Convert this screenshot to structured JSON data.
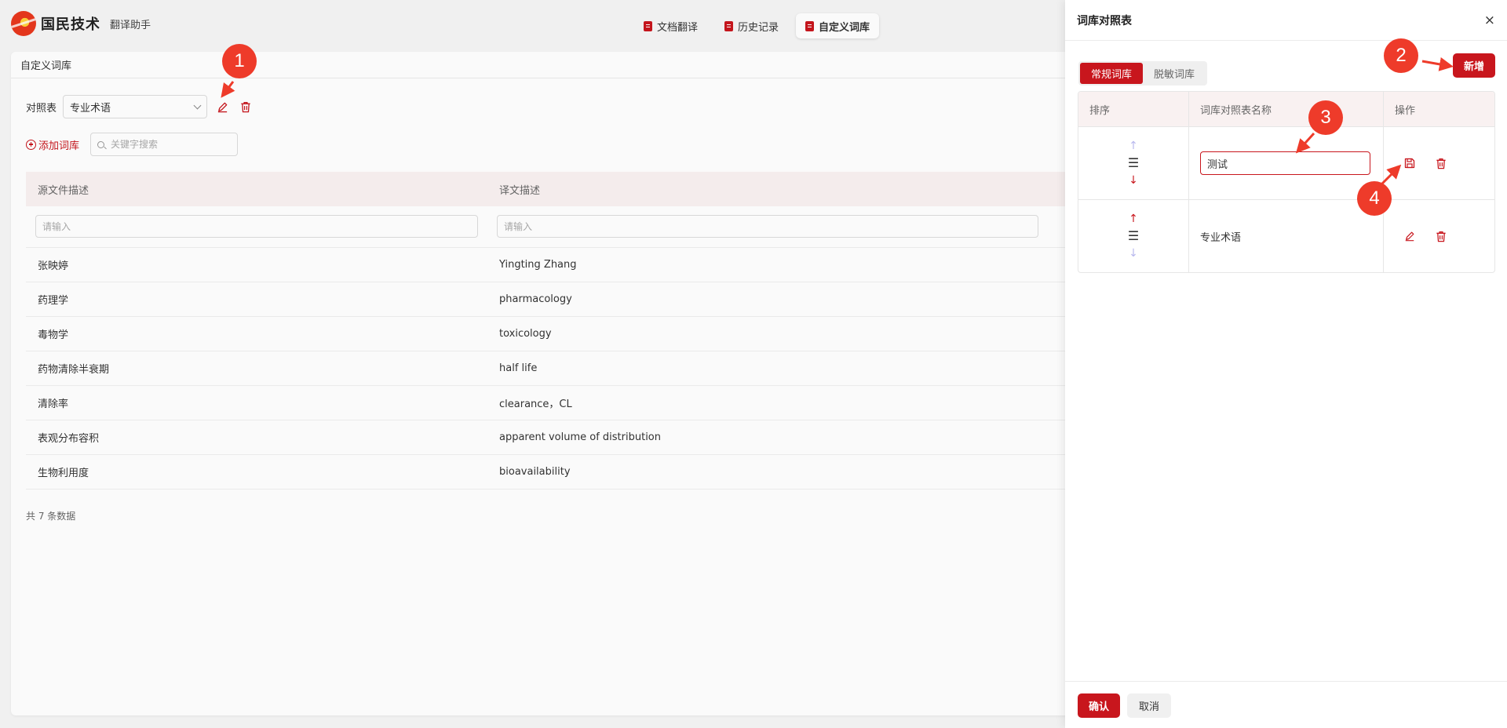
{
  "app": {
    "logo_text": "国民技术",
    "subtitle": "翻译助手"
  },
  "nav": {
    "tabs": [
      {
        "label": "文档翻译"
      },
      {
        "label": "历史记录"
      },
      {
        "label": "自定义词库"
      }
    ]
  },
  "main": {
    "card_title": "自定义词库",
    "selector_label": "对照表",
    "selected_table": "专业术语",
    "add_label": "添加词库",
    "search_placeholder": "关键字搜索",
    "columns": [
      "源文件描述",
      "译文描述"
    ],
    "filter_placeholder": "请输入",
    "rows": [
      {
        "source": "张映婷",
        "target": "Yingting Zhang"
      },
      {
        "source": "药理学",
        "target": "pharmacology"
      },
      {
        "source": "毒物学",
        "target": "toxicology"
      },
      {
        "source": "药物清除半衰期",
        "target": "half life"
      },
      {
        "source": "清除率",
        "target": "clearance，CL"
      },
      {
        "source": "表观分布容积",
        "target": "apparent volume of distribution"
      },
      {
        "source": "生物利用度",
        "target": "bioavailability"
      }
    ],
    "total_text": "共 7 条数据"
  },
  "drawer": {
    "title": "词库对照表",
    "close_glyph": "×",
    "segments": [
      "常规词库",
      "脱敏词库"
    ],
    "new_label": "新增",
    "columns": [
      "排序",
      "词库对照表名称",
      "操作"
    ],
    "rows": [
      {
        "name_value": "测试",
        "editing": true
      },
      {
        "name": "专业术语",
        "editing": false
      }
    ],
    "sort_glyphs": {
      "up": "↑",
      "drag": "☰",
      "down": "↓"
    },
    "confirm_label": "确认",
    "cancel_label": "取消"
  },
  "annotations": {
    "badges": [
      "1",
      "2",
      "3",
      "4"
    ]
  },
  "colors": {
    "accent": "#c8161d",
    "annotation": "#ee3b2a",
    "faded_arrow": "#b8b8ee"
  },
  "icons": [
    "logo-icon",
    "doc-icon",
    "history-icon",
    "lexicon-icon",
    "edit-icon",
    "trash-icon",
    "save-icon",
    "plus-circle-icon",
    "search-icon",
    "chevron-down-icon",
    "close-icon",
    "drag-handle-icon"
  ]
}
